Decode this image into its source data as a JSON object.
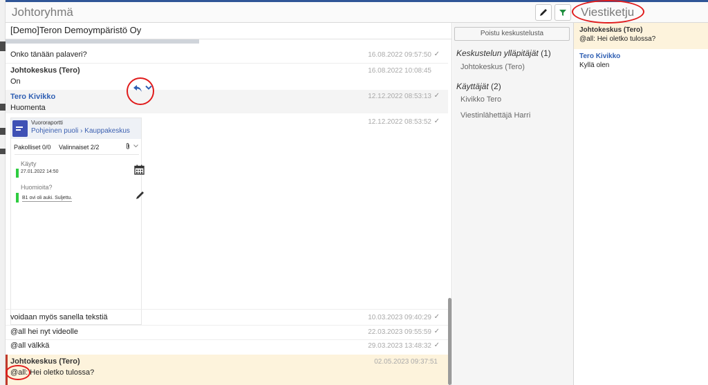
{
  "header": {
    "title": "Johtoryhmä"
  },
  "org_name": "[Demo]Teron Demoympäristö Oy",
  "messages": [
    {
      "author": "",
      "text": "Onko tänään palaveri?",
      "time": "16.08.2022 09:57:50"
    },
    {
      "author": "Johtokeskus (Tero)",
      "text": "On",
      "time": "16.08.2022 10:08:45"
    },
    {
      "author": "Tero Kivikko",
      "text": "Huomenta",
      "time": "12.12.2022 08:53:13"
    },
    {
      "author": "",
      "text": "",
      "time": "12.12.2022 08:53:52"
    },
    {
      "author": "",
      "text": "voidaan myös sanella tekstiä",
      "time": "10.03.2023 09:40:29"
    },
    {
      "author": "",
      "text": "@all hei nyt videolle",
      "time": "22.03.2023 09:55:59"
    },
    {
      "author": "",
      "text": "@all välkkä",
      "time": "29.03.2023 13:48:32"
    },
    {
      "author": "Johtokeskus (Tero)",
      "text": "@all: Hei oletko tulossa?",
      "time": "02.05.2023 09:37:51"
    }
  ],
  "report_card": {
    "type": "Vuororaportti",
    "location_from": "Pohjeinen puoli",
    "location_to": "Kauppakeskus",
    "mandatory": "Pakolliset 0/0",
    "optional": "Valinnaiset 2/2",
    "field1_label": "Käyty",
    "field1_value": "27.01.2022 14:50",
    "field2_label": "Huomioita?",
    "field2_value": "B1 ovi oli auki. Suljettu."
  },
  "members": {
    "leave_label": "Poistu keskustelusta",
    "admins_title": "Keskustelun ylläpitäjät",
    "admins_count": "(1)",
    "admins": [
      "Johtokeskus (Tero)"
    ],
    "users_title": "Käyttäjät",
    "users_count": "(2)",
    "users": [
      "Kivikko Tero",
      "Viestinlähettäjä Harri"
    ]
  },
  "thread": {
    "title": "Viestiketju",
    "items": [
      {
        "author": "Johtokeskus (Tero)",
        "text": "@all: Hei oletko tulossa?"
      },
      {
        "author": "Tero Kivikko",
        "text": "Kyllä olen"
      }
    ]
  },
  "colors": {
    "accent": "#2f5fb3",
    "highlight": "#fdf3dc",
    "annotation": "#e01b1b",
    "status_green": "#2ecc40"
  }
}
